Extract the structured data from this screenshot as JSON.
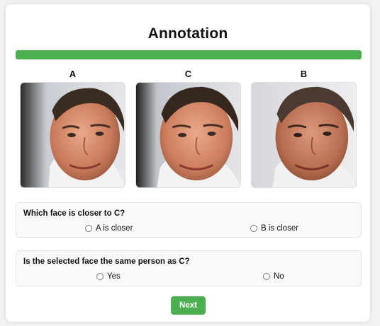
{
  "page": {
    "title": "Annotation"
  },
  "progress": {
    "fraction": 1.0,
    "color": "#4caf50"
  },
  "faces": [
    {
      "label": "A"
    },
    {
      "label": "C"
    },
    {
      "label": "B"
    }
  ],
  "question1": {
    "text": "Which face is closer to C?",
    "options": [
      "A is closer",
      "B is closer"
    ]
  },
  "question2": {
    "text": "Is the selected face the same person as C?",
    "options": [
      "Yes",
      "No"
    ]
  },
  "next_button": {
    "label": "Next"
  }
}
